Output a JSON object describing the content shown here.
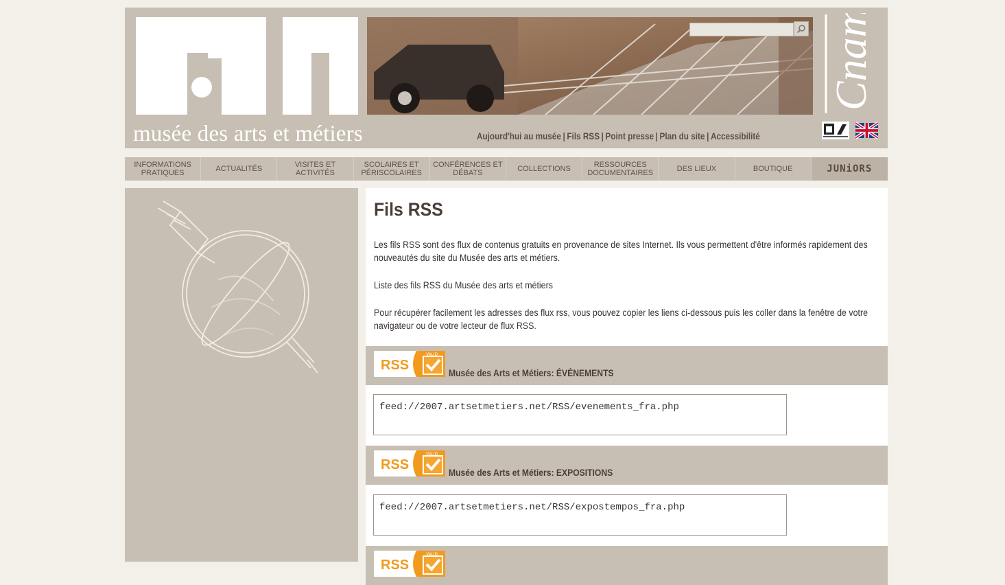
{
  "header": {
    "site_name": "musée des arts et métiers",
    "cnam_logo_text": "Cnam",
    "util_links": [
      "Aujourd'hui au musée",
      "Fils RSS",
      "Point presse",
      "Plan du site",
      "Accessibilité"
    ],
    "search_placeholder": ""
  },
  "nav": {
    "items": [
      "INFORMATIONS PRATIQUES",
      "ACTUALITÉS",
      "VISITES ET ACTIVITÉS",
      "SCOLAIRES ET PÉRISCOLAIRES",
      "CONFÉRENCES ET DÉBATS",
      "COLLECTIONS",
      "RESSOURCES DOCUMENTAIRES",
      "DES LIEUX",
      "BOUTIQUE",
      "JUNiORS"
    ]
  },
  "main": {
    "title": "Fils RSS",
    "intro_1": "Les fils RSS sont des flux de contenus gratuits en provenance de sites Internet. Ils vous permettent d'être informés rapidement des nouveautés du site du Musée des arts et métiers.",
    "intro_2": "Liste des fils RSS du Musée des arts et métiers",
    "intro_3": "Pour récupérer facilement les adresses des flux rss, vous pouvez copier les liens ci-dessous puis les coller dans la fenêtre de votre navigateur ou de votre lecteur de flux RSS.",
    "rss_badge_text": "RSS",
    "rss_badge_check": "VALID",
    "feeds": [
      {
        "title": "Musée des Arts et Métiers: ÉVÉNEMENTS",
        "url": "feed://2007.artsetmetiers.net/RSS/evenements_fra.php"
      },
      {
        "title": "Musée des Arts et Métiers: EXPOSITIONS",
        "url": "feed://2007.artsetmetiers.net/RSS/expostempos_fra.php"
      }
    ]
  },
  "colors": {
    "page_bg": "#f3f0ea",
    "panel": "#c7bfb3",
    "rss_orange": "#f29a1e",
    "text_dark": "#4a3f38"
  },
  "icons": [
    "search-icon",
    "accessibility-badge-icon",
    "uk-flag-icon",
    "rss-valid-icon",
    "cnam-logo",
    "museum-logo"
  ]
}
